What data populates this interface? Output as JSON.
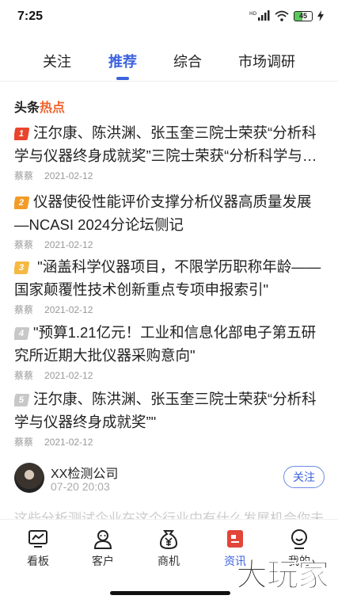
{
  "status": {
    "time": "7:25",
    "battery": "45"
  },
  "tabs": [
    {
      "label": "关注"
    },
    {
      "label": "推荐"
    },
    {
      "label": "综合"
    },
    {
      "label": "市场调研"
    }
  ],
  "section": {
    "title_prefix": "头条",
    "title_hot": "热点"
  },
  "news": [
    {
      "rank": "1",
      "title": "汪尔康、陈洪渊、张玉奎三院士荣获“分析科学与仪器终身成就奖”三院士荣获“分析科学与仪器终身成就奖”",
      "author": "蔡蔡",
      "date": "2021-02-12"
    },
    {
      "rank": "2",
      "title": "仪器使役性能评价支撑分析仪器高质量发展—NCASI 2024分论坛侧记",
      "author": "蔡蔡",
      "date": "2021-02-12"
    },
    {
      "rank": "3",
      "title": " \"涵盖科学仪器项目，不限学历职称年龄——国家颠覆性技术创新重点专项申报索引\"",
      "author": "蔡蔡",
      "date": "2021-02-12"
    },
    {
      "rank": "4",
      "title": "\"预算1.21亿元！工业和信息化部电子第五研究所近期大批仪器采购意向\"",
      "author": "蔡蔡",
      "date": "2021-02-12"
    },
    {
      "rank": "5",
      "title": "汪尔康、陈洪渊、张玉奎三院士荣获“分析科学与仪器终身成就奖”\"",
      "author": "蔡蔡",
      "date": "2021-02-12"
    }
  ],
  "rank_colors": [
    "#e8452c",
    "#f39b27",
    "#f5b942",
    "#c8c8c8",
    "#c8c8c8"
  ],
  "company": {
    "name": "XX检测公司",
    "time": "07-20 20:03",
    "follow_label": "关注"
  },
  "faded_preview": "这些分析测试企业在这个行业中有什么发展机会你未来",
  "nav": [
    {
      "label": "看板",
      "icon": "chart-board-icon"
    },
    {
      "label": "客户",
      "icon": "user-icon"
    },
    {
      "label": "商机",
      "icon": "yuan-bag-icon"
    },
    {
      "label": "资讯",
      "icon": "news-icon"
    },
    {
      "label": "我的",
      "icon": "profile-icon"
    }
  ],
  "accent_color": "#3c63dd",
  "watermark": "大玩家"
}
